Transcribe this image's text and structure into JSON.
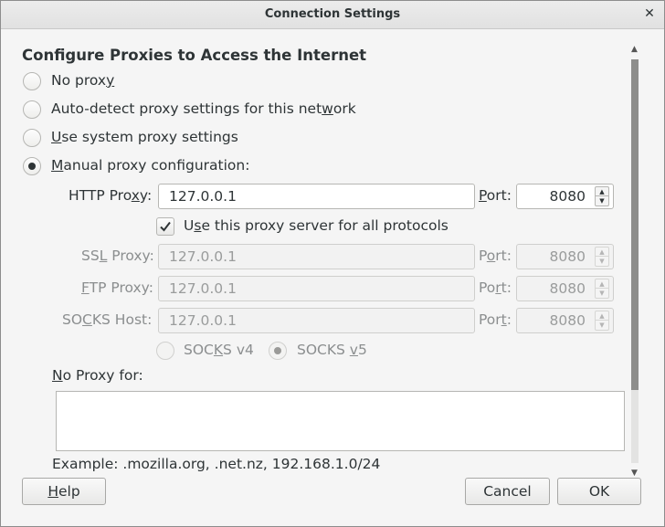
{
  "window": {
    "title": "Connection Settings",
    "close_glyph": "✕"
  },
  "heading": "Configure Proxies to Access the Internet",
  "proxy_options": [
    {
      "pre": "No prox",
      "mn": "y",
      "post": "",
      "selected": false
    },
    {
      "pre": "Auto-detect proxy settings for this net",
      "mn": "w",
      "post": "ork",
      "selected": false
    },
    {
      "pre": "",
      "mn": "U",
      "post": "se system proxy settings",
      "selected": false
    },
    {
      "pre": "",
      "mn": "M",
      "post": "anual proxy configuration:",
      "selected": true
    }
  ],
  "http": {
    "label_pre": "HTTP Pro",
    "label_mn": "x",
    "label_post": "y:",
    "value": "127.0.0.1",
    "port_mn": "P",
    "port_post": "ort:",
    "port": "8080"
  },
  "share_all": {
    "pre": "U",
    "mn": "s",
    "post": "e this proxy server for all protocols",
    "checked": true
  },
  "ssl": {
    "label_pre": "SS",
    "label_mn": "L",
    "label_post": " Proxy:",
    "value": "127.0.0.1",
    "port_pre": "P",
    "port_mn": "o",
    "port_post": "rt:",
    "port": "8080"
  },
  "ftp": {
    "label_pre": "",
    "label_mn": "F",
    "label_post": "TP Proxy:",
    "value": "127.0.0.1",
    "port_pre": "Po",
    "port_mn": "r",
    "port_post": "t:",
    "port": "8080"
  },
  "socks": {
    "label_pre": "SO",
    "label_mn": "C",
    "label_post": "KS Host:",
    "value": "127.0.0.1",
    "port_pre": "Por",
    "port_mn": "t",
    "port_post": ":",
    "port": "8080"
  },
  "socks_version": {
    "v4": {
      "pre": "SOC",
      "mn": "K",
      "post": "S v4",
      "selected": false
    },
    "v5": {
      "pre": "SOCKS ",
      "mn": "v",
      "post": "5",
      "selected": true
    }
  },
  "no_proxy": {
    "label_mn": "N",
    "label_post": "o Proxy for:",
    "value": "",
    "example": "Example: .mozilla.org, .net.nz, 192.168.1.0/24"
  },
  "buttons": {
    "help_mn": "H",
    "help_post": "elp",
    "cancel": "Cancel",
    "ok": "OK"
  }
}
